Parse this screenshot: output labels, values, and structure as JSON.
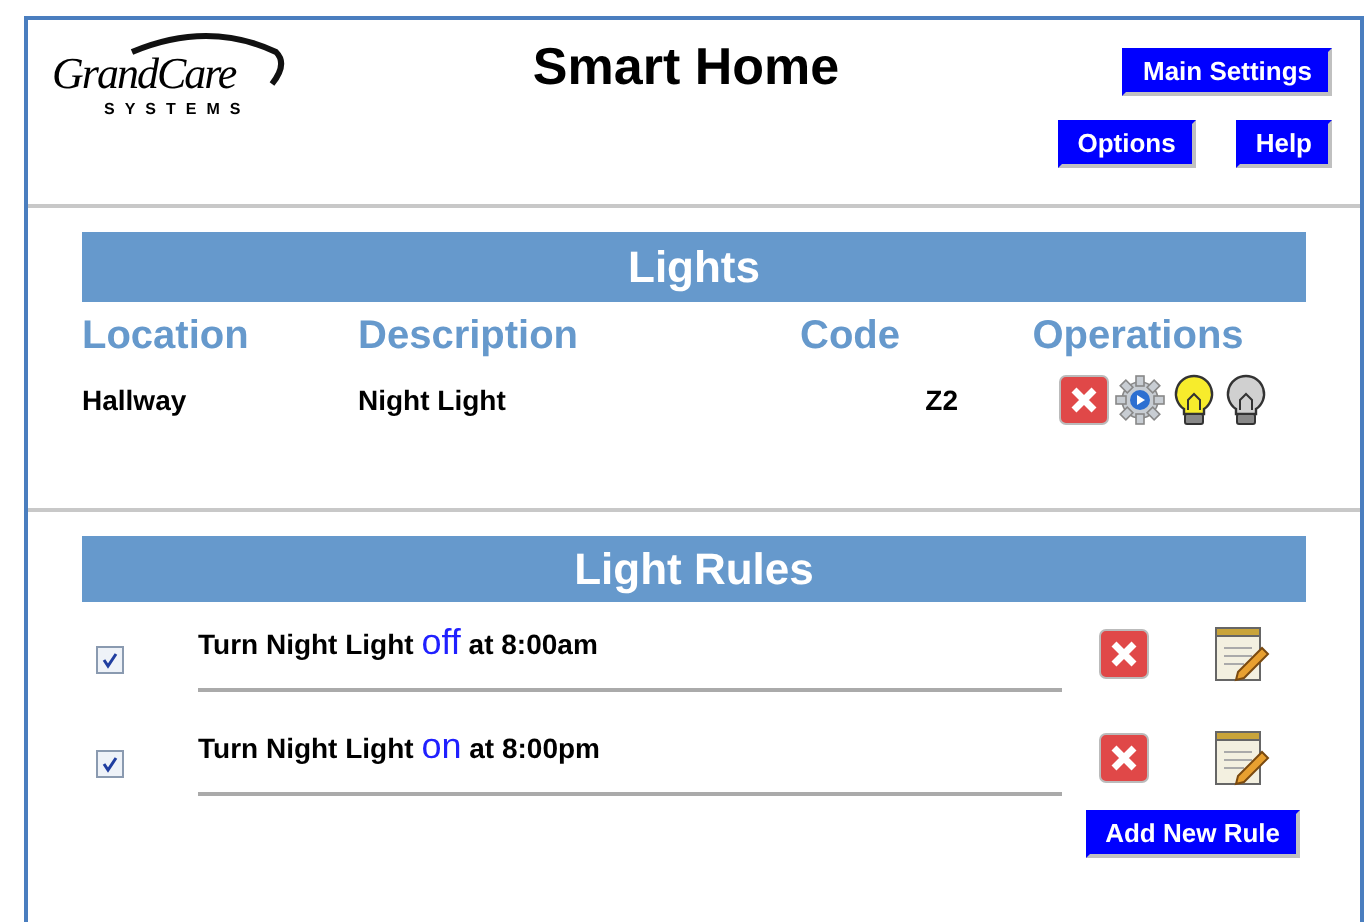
{
  "logo": {
    "name": "GrandCare",
    "tagline": "SYSTEMS"
  },
  "title": "Smart Home",
  "header_buttons": [
    "Main Settings",
    "Options",
    "Help"
  ],
  "lights": {
    "title": "Lights",
    "columns": [
      "Location",
      "Description",
      "Code",
      "Operations"
    ],
    "rows": [
      {
        "location": "Hallway",
        "description": "Night Light",
        "code": "Z2"
      }
    ]
  },
  "light_rules": {
    "title": "Light Rules",
    "rules": [
      {
        "checked": true,
        "before": "Turn Night Light",
        "state": "off",
        "after": "at 8:00am"
      },
      {
        "checked": true,
        "before": "Turn Night Light",
        "state": "on",
        "after": "at 8:00pm"
      }
    ],
    "add_button": "Add New Rule"
  }
}
